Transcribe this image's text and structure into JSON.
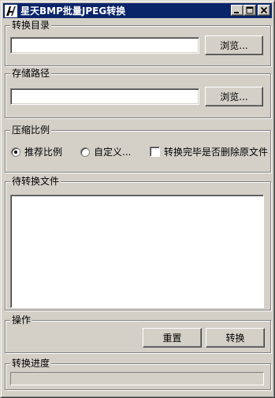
{
  "window": {
    "title": "星天BMP批量JPEG转换",
    "app_icon": "app-icon"
  },
  "source_dir": {
    "label": "转换目录",
    "value": "",
    "browse_label": "浏览..."
  },
  "save_path": {
    "label": "存储路径",
    "value": "",
    "browse_label": "浏览..."
  },
  "compression": {
    "label": "压缩比例",
    "options": [
      "推荐比例",
      "自定义..."
    ],
    "selected": "推荐比例",
    "delete_after_label": "转换完毕是否删除原文件",
    "delete_after_checked": false
  },
  "pending_files": {
    "label": "待转换文件",
    "items": []
  },
  "actions": {
    "label": "操作",
    "reset_label": "重置",
    "convert_label": "转换"
  },
  "progress": {
    "label": "转换进度",
    "value": 0
  },
  "colors": {
    "titlebar": "#0a246a",
    "face": "#d4d0c8"
  }
}
